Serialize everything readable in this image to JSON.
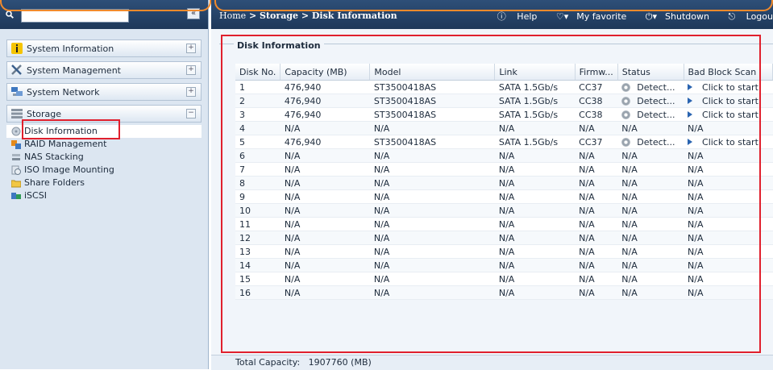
{
  "search": {
    "value": "",
    "collapse_label": "«"
  },
  "nav": {
    "groups": [
      {
        "label": "System Information",
        "toggle": "+"
      },
      {
        "label": "System Management",
        "toggle": "+"
      },
      {
        "label": "System Network",
        "toggle": "+"
      },
      {
        "label": "Storage",
        "toggle": "−"
      }
    ],
    "storage_items": [
      {
        "label": "Disk Information"
      },
      {
        "label": "RAID Management"
      },
      {
        "label": "NAS Stacking"
      },
      {
        "label": "ISO Image Mounting"
      },
      {
        "label": "Share Folders"
      },
      {
        "label": "iSCSI"
      }
    ]
  },
  "header": {
    "breadcrumb_home": "Home",
    "breadcrumb_rest": " > Storage > Disk Information",
    "help": "Help",
    "favorite": "My favorite",
    "shutdown": "Shutdown",
    "logout": "Logou"
  },
  "panel": {
    "legend": "Disk Information"
  },
  "table": {
    "columns": [
      "Disk No.",
      "Capacity (MB)",
      "Model",
      "Link",
      "Firmw...",
      "Status",
      "Bad Block Scan"
    ],
    "rows": [
      [
        "1",
        "476,940",
        "ST3500418AS",
        "SATA 1.5Gb/s",
        "CC37",
        "Detect...",
        "Click to start"
      ],
      [
        "2",
        "476,940",
        "ST3500418AS",
        "SATA 1.5Gb/s",
        "CC38",
        "Detect...",
        "Click to start"
      ],
      [
        "3",
        "476,940",
        "ST3500418AS",
        "SATA 1.5Gb/s",
        "CC38",
        "Detect...",
        "Click to start"
      ],
      [
        "4",
        "N/A",
        "N/A",
        "N/A",
        "N/A",
        "N/A",
        "N/A"
      ],
      [
        "5",
        "476,940",
        "ST3500418AS",
        "SATA 1.5Gb/s",
        "CC37",
        "Detect...",
        "Click to start"
      ],
      [
        "6",
        "N/A",
        "N/A",
        "N/A",
        "N/A",
        "N/A",
        "N/A"
      ],
      [
        "7",
        "N/A",
        "N/A",
        "N/A",
        "N/A",
        "N/A",
        "N/A"
      ],
      [
        "8",
        "N/A",
        "N/A",
        "N/A",
        "N/A",
        "N/A",
        "N/A"
      ],
      [
        "9",
        "N/A",
        "N/A",
        "N/A",
        "N/A",
        "N/A",
        "N/A"
      ],
      [
        "10",
        "N/A",
        "N/A",
        "N/A",
        "N/A",
        "N/A",
        "N/A"
      ],
      [
        "11",
        "N/A",
        "N/A",
        "N/A",
        "N/A",
        "N/A",
        "N/A"
      ],
      [
        "12",
        "N/A",
        "N/A",
        "N/A",
        "N/A",
        "N/A",
        "N/A"
      ],
      [
        "13",
        "N/A",
        "N/A",
        "N/A",
        "N/A",
        "N/A",
        "N/A"
      ],
      [
        "14",
        "N/A",
        "N/A",
        "N/A",
        "N/A",
        "N/A",
        "N/A"
      ],
      [
        "15",
        "N/A",
        "N/A",
        "N/A",
        "N/A",
        "N/A",
        "N/A"
      ],
      [
        "16",
        "N/A",
        "N/A",
        "N/A",
        "N/A",
        "N/A",
        "N/A"
      ]
    ]
  },
  "footer": {
    "total_label": "Total Capacity:",
    "total_value": "1907760 (MB)"
  },
  "colors": {
    "header_bg": "#1e3859",
    "highlight": "#e0202d",
    "accent_orange": "#f08a2c"
  }
}
